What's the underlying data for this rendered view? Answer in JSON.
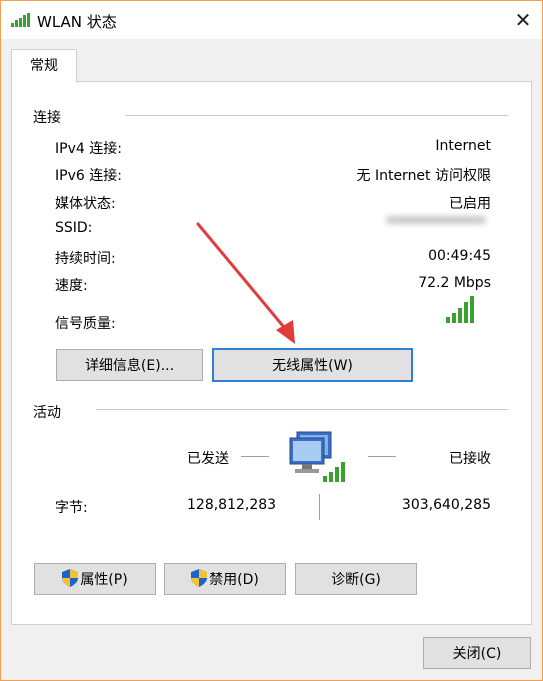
{
  "window": {
    "title": "WLAN 状态",
    "close_glyph": "✕"
  },
  "tabs": [
    {
      "label": "常规"
    }
  ],
  "connection": {
    "group_title": "连接",
    "rows": [
      {
        "label": "IPv4 连接:",
        "value": "Internet"
      },
      {
        "label": "IPv6 连接:",
        "value": "无 Internet 访问权限"
      },
      {
        "label": "媒体状态:",
        "value": "已启用"
      },
      {
        "label": "SSID:",
        "value": ""
      },
      {
        "label": "持续时间:",
        "value": "00:49:45"
      },
      {
        "label": "速度:",
        "value": "72.2 Mbps"
      }
    ],
    "signal_label": "信号质量:",
    "signal_bars_filled": 5,
    "signal_bars_total": 5
  },
  "buttons": {
    "details": "详细信息(E)...",
    "wireless_props": "无线属性(W)",
    "properties": "属性(P)",
    "disable": "禁用(D)",
    "diagnose": "诊断(G)",
    "close": "关闭(C)"
  },
  "activity": {
    "group_title": "活动",
    "sent_label": "已发送",
    "received_label": "已接收",
    "bytes_label": "字节:",
    "bytes_sent": "128,812,283",
    "bytes_received": "303,640,285"
  },
  "colors": {
    "signal_green": "#3aa030",
    "accent_blue": "#2f7fd6",
    "arrow_red": "#e03c3c",
    "window_border": "#f0a050"
  }
}
